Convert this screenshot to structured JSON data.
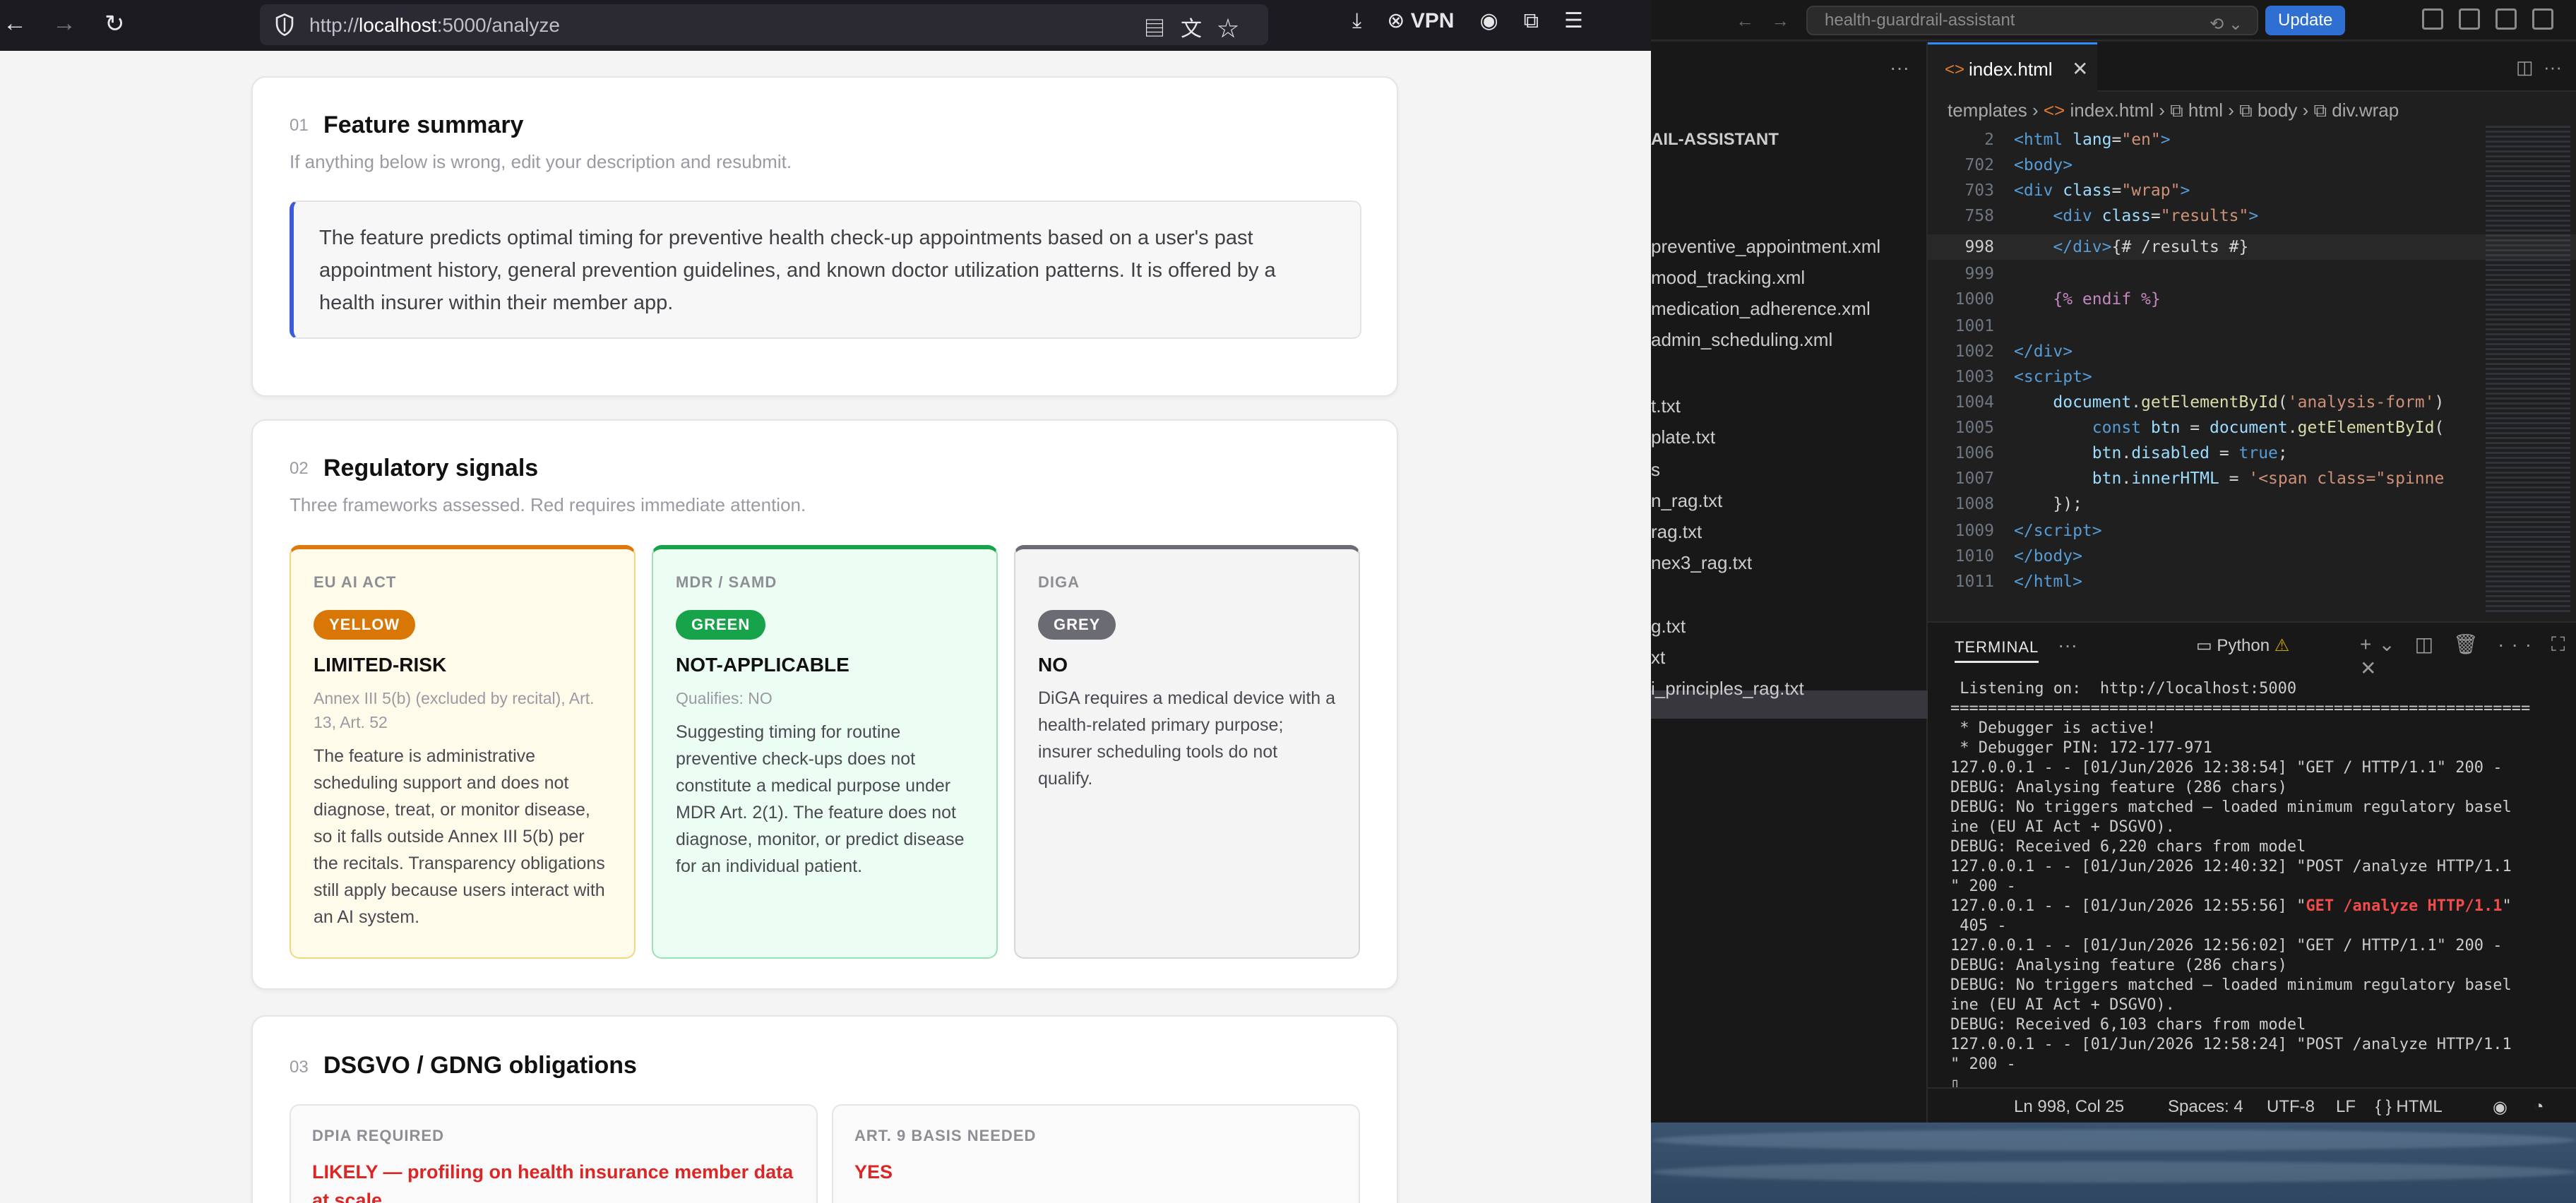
{
  "browser": {
    "url_prefix": "http://",
    "url_host": "localhost",
    "url_path": ":5000/analyze",
    "vpn_label": "VPN"
  },
  "page": {
    "sections": {
      "summary": {
        "num": "01",
        "title": "Feature summary",
        "subtitle": "If anything below is wrong, edit your description and resubmit.",
        "text": "The feature predicts optimal timing for preventive health check-up appointments based on a user's past appointment history, general prevention guidelines, and known doctor utilization patterns. It is offered by a health insurer within their member app."
      },
      "signals": {
        "num": "02",
        "title": "Regulatory signals",
        "subtitle": "Three frameworks assessed. Red requires immediate attention.",
        "cards": [
          {
            "label": "EU AI ACT",
            "badge": "YELLOW",
            "verdict": "LIMITED-RISK",
            "ref": "Annex III 5(b) (excluded by recital), Art. 13, Art. 52",
            "description": "The feature is administrative scheduling support and does not diagnose, treat, or monitor disease, so it falls outside Annex III 5(b) per the recitals. Transparency obligations still apply because users interact with an AI system."
          },
          {
            "label": "MDR / SAMD",
            "badge": "GREEN",
            "verdict": "NOT-APPLICABLE",
            "ref": "Qualifies: NO",
            "description": "Suggesting timing for routine preventive check-ups does not constitute a medical purpose under MDR Art. 2(1). The feature does not diagnose, monitor, or predict disease for an individual patient."
          },
          {
            "label": "DIGA",
            "badge": "GREY",
            "verdict": "NO",
            "ref": "",
            "description": "DiGA requires a medical device with a health-related primary purpose; insurer scheduling tools do not qualify."
          }
        ]
      },
      "obligations": {
        "num": "03",
        "title": "DSGVO / GDNG obligations",
        "items": [
          {
            "label": "DPIA REQUIRED",
            "value": "LIKELY — profiling on health insurance member data at scale"
          },
          {
            "label": "ART. 9 BASIS NEEDED",
            "value": "YES"
          }
        ]
      }
    }
  },
  "vscode": {
    "search": "health-guardrail-assistant",
    "update_label": "Update",
    "sidebar_title": "AIL-ASSISTANT",
    "sidebar_files": [
      "preventive_appointment.xml",
      "mood_tracking.xml",
      "medication_adherence.xml",
      "admin_scheduling.xml",
      "t.txt",
      "plate.txt",
      "s",
      "n_rag.txt",
      "rag.txt",
      "nex3_rag.txt",
      "g.txt",
      "xt",
      "i_principles_rag.txt"
    ],
    "tab_label": "index.html",
    "breadcrumb": [
      "templates",
      "index.html",
      "html",
      "body",
      "div.wrap"
    ],
    "code_lines": [
      {
        "num": "2",
        "html": "<span class=\"tag\">&lt;html</span> <span class=\"attr\">lang</span>=<span class=\"str\">\"en\"</span><span class=\"tag\">&gt;</span>"
      },
      {
        "num": "702",
        "html": "<span class=\"tag\">&lt;body&gt;</span>"
      },
      {
        "num": "703",
        "html": "<span class=\"tag\">&lt;div</span> <span class=\"attr\">class</span>=<span class=\"str\">\"wrap\"</span><span class=\"tag\">&gt;</span>"
      },
      {
        "num": "758",
        "html": "    <span class=\"tag\">&lt;div</span> <span class=\"attr\">class</span>=<span class=\"str\">\"results\"</span><span class=\"tag\">&gt;</span>"
      },
      {
        "num": "998",
        "html": "    <span class=\"tag\">&lt;/div&gt;</span>{# /results #}"
      },
      {
        "num": "999",
        "html": ""
      },
      {
        "num": "1000",
        "html": "    <span class=\"tpl\">{% endif %}</span>"
      },
      {
        "num": "1001",
        "html": ""
      },
      {
        "num": "1002",
        "html": "<span class=\"tag\">&lt;/div&gt;</span>"
      },
      {
        "num": "1003",
        "html": "<span class=\"tag\">&lt;script&gt;</span>"
      },
      {
        "num": "1004",
        "html": "    <span class=\"var\">document</span>.<span class=\"fn\">getElementById</span>(<span class=\"str\">'analysis-form'</span>)"
      },
      {
        "num": "1005",
        "html": "        <span class=\"kw\">const</span> <span class=\"var\">btn</span> = <span class=\"var\">document</span>.<span class=\"fn\">getElementById</span>("
      },
      {
        "num": "1006",
        "html": "        <span class=\"var\">btn</span>.<span class=\"var\">disabled</span> = <span class=\"kw\">true</span>;"
      },
      {
        "num": "1007",
        "html": "        <span class=\"var\">btn</span>.<span class=\"var\">innerHTML</span> = <span class=\"str\">'&lt;span class=\"spinne</span>"
      },
      {
        "num": "1008",
        "html": "    });"
      },
      {
        "num": "1009",
        "html": "<span class=\"tag\">&lt;/script&gt;</span>"
      },
      {
        "num": "1010",
        "html": "<span class=\"tag\">&lt;/body&gt;</span>"
      },
      {
        "num": "1011",
        "html": "<span class=\"tag\">&lt;/html&gt;</span>"
      }
    ],
    "terminal_title": "TERMINAL",
    "terminal_shell": "Python",
    "terminal_html": " Listening on:  http://localhost:5000\n==============================================================\n * Debugger is active!\n * Debugger PIN: 172-177-971\n127.0.0.1 - - [01/Jun/2026 12:38:54] \"GET / HTTP/1.1\" 200 -\nDEBUG: Analysing feature (286 chars)\nDEBUG: No triggers matched — loaded minimum regulatory basel\nine (EU AI Act + DSGVO).\nDEBUG: Received 6,220 chars from model\n127.0.0.1 - - [01/Jun/2026 12:40:32] \"POST /analyze HTTP/1.1\n\" 200 -\n127.0.0.1 - - [01/Jun/2026 12:55:56] \"<span class=\"term-red\">GET /analyze HTTP/1.1</span>\"\n 405 -\n127.0.0.1 - - [01/Jun/2026 12:56:02] \"GET / HTTP/1.1\" 200 -\nDEBUG: Analysing feature (286 chars)\nDEBUG: No triggers matched — loaded minimum regulatory basel\nine (EU AI Act + DSGVO).\nDEBUG: Received 6,103 chars from model\n127.0.0.1 - - [01/Jun/2026 12:58:24] \"POST /analyze HTTP/1.1\n\" 200 -\n▯",
    "status": {
      "position": "Ln 998, Col 25",
      "spaces": "Spaces: 4",
      "encoding": "UTF-8",
      "eol": "LF",
      "language": "{ } HTML"
    }
  }
}
